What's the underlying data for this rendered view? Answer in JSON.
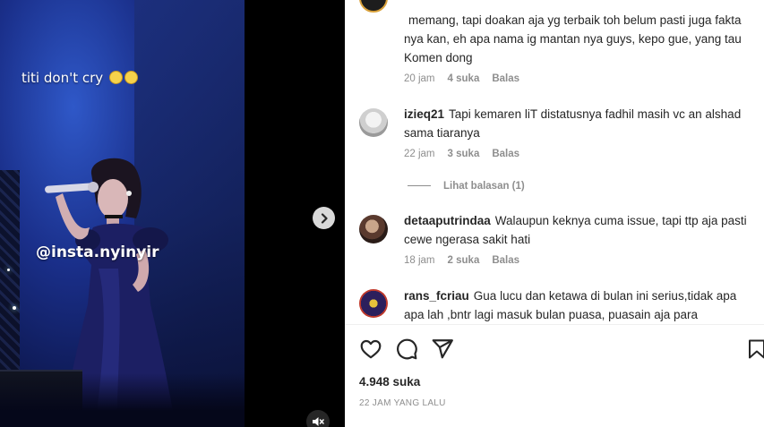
{
  "media": {
    "caption_text": "titi don't cry",
    "watermark": "@insta.nyinyir"
  },
  "comments": [
    {
      "username": "",
      "text": "memang, tapi doakan aja yg terbaik toh belum pasti juga fakta nya kan, eh apa nama ig mantan nya guys, kepo gue, yang tau Komen dong",
      "time": "20 jam",
      "likes": "4 suka",
      "reply": "Balas"
    },
    {
      "username": "izieq21",
      "text": "Tapi kemaren liT distatusnya fadhil masih vc an alshad sama tiaranya",
      "time": "22 jam",
      "likes": "3 suka",
      "reply": "Balas",
      "view_replies": "Lihat balasan (1)"
    },
    {
      "username": "detaaputrindaa",
      "text": "Walaupun keknya cuma issue, tapi ttp aja pasti cewe ngerasa sakit hati",
      "time": "18 jam",
      "likes": "2 suka",
      "reply": "Balas"
    },
    {
      "username": "rans_fcriau",
      "text": "Gua lucu dan ketawa di bulan ini serius,tidak apa apa lah ,bntr lagi masuk bulan puasa, puasain aja para"
    }
  ],
  "post": {
    "likes_count": "4.948 suka",
    "posted_time": "22 JAM YANG LALU"
  },
  "icons": {
    "like": "heart-icon",
    "comment": "comment-icon",
    "share": "share-icon",
    "save": "bookmark-icon",
    "next": "chevron-right-icon",
    "mute": "muted-speaker-icon"
  },
  "colors": {
    "text": "#262626",
    "secondary": "#8e8e8e",
    "divider": "#efefef"
  }
}
